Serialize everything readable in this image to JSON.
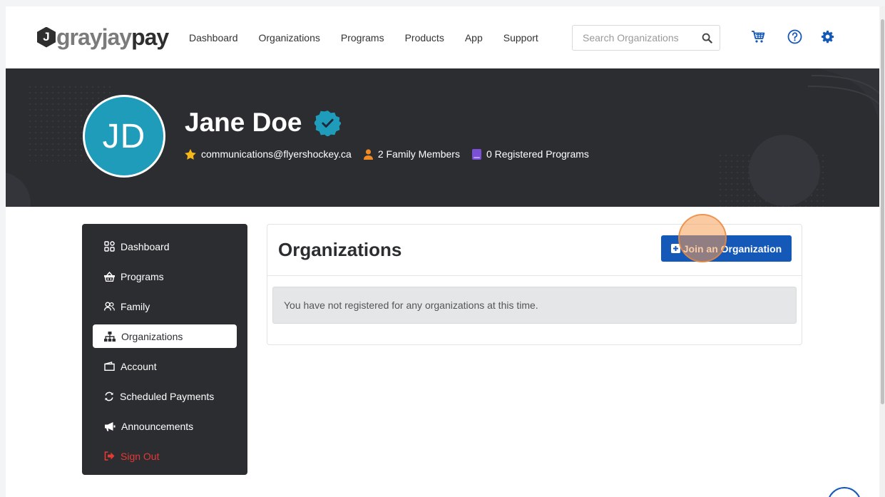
{
  "brand": {
    "badge": "J",
    "name_part1": "grayjay",
    "name_part2": "pay"
  },
  "nav": {
    "links": [
      "Dashboard",
      "Organizations",
      "Programs",
      "Products",
      "App",
      "Support"
    ],
    "search_placeholder": "Search Organizations"
  },
  "profile": {
    "initials": "JD",
    "name": "Jane Doe",
    "email": "communications@flyershockey.ca",
    "family": "2 Family Members",
    "programs": "0 Registered Programs"
  },
  "sidebar": {
    "items": [
      {
        "label": "Dashboard",
        "icon": "dashboard-icon"
      },
      {
        "label": "Programs",
        "icon": "basket-icon"
      },
      {
        "label": "Family",
        "icon": "users-icon"
      },
      {
        "label": "Organizations",
        "icon": "sitemap-icon",
        "active": true
      },
      {
        "label": "Account",
        "icon": "wallet-icon"
      },
      {
        "label": "Scheduled Payments",
        "icon": "sync-icon"
      },
      {
        "label": "Announcements",
        "icon": "megaphone-icon"
      },
      {
        "label": "Sign Out",
        "icon": "sign-out-icon"
      }
    ]
  },
  "main": {
    "title": "Organizations",
    "join_button": "Join an Organization",
    "empty_message": "You have not registered for any organizations at this time."
  },
  "colors": {
    "accent": "#1458b8",
    "dark": "#2b2d31",
    "avatar": "#1e9cba",
    "danger": "#e53935"
  }
}
